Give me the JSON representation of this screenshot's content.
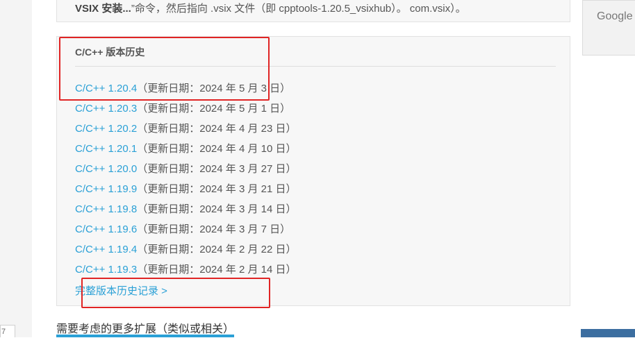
{
  "top_card": {
    "bold_text": "VSIX 安装...",
    "text": "”命令，然后指向 .vsix 文件（即 cpptools-1.20.5_vsixhub）。 com.vsix）。"
  },
  "history": {
    "title": "C/C++ 版本历史",
    "versions": [
      {
        "name": "C/C++ 1.20.4",
        "date": "（更新日期：2024 年 5 月 3 日）"
      },
      {
        "name": "C/C++ 1.20.3",
        "date": "（更新日期：2024 年 5 月 1 日）"
      },
      {
        "name": "C/C++ 1.20.2",
        "date": "（更新日期：2024 年 4 月 23 日）"
      },
      {
        "name": "C/C++ 1.20.1",
        "date": "（更新日期：2024 年 4 月 10 日）"
      },
      {
        "name": "C/C++ 1.20.0",
        "date": "（更新日期：2024 年 3 月 27 日）"
      },
      {
        "name": "C/C++ 1.19.9",
        "date": "（更新日期：2024 年 3 月 21 日）"
      },
      {
        "name": "C/C++ 1.19.8",
        "date": "（更新日期：2024 年 3 月 14 日）"
      },
      {
        "name": "C/C++ 1.19.6",
        "date": "（更新日期：2024 年 3 月 7 日）"
      },
      {
        "name": "C/C++ 1.19.4",
        "date": "（更新日期：2024 年 2 月 22 日）"
      },
      {
        "name": "C/C++ 1.19.3",
        "date": "（更新日期：2024 年 2 月 14 日）"
      }
    ],
    "full_history_link": "完整版本历史记录 >"
  },
  "related": {
    "heading": "需要考虑的更多扩展（类似或相关）"
  },
  "sidebar": {
    "google_label": "Google T"
  },
  "left_rail": {
    "tab_label": "7"
  },
  "colors": {
    "link": "#2aa0d6",
    "highlight_box": "#e02424",
    "card_background": "#f7f7f7"
  }
}
